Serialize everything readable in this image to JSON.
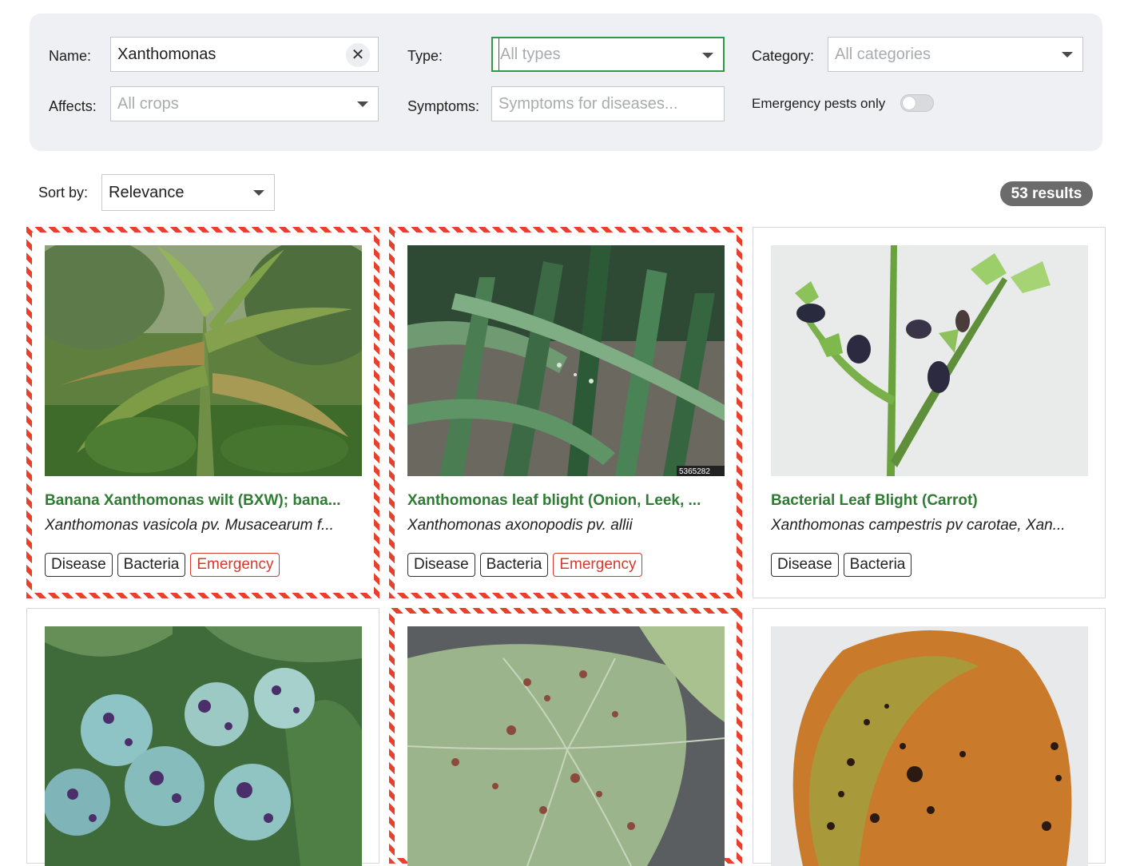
{
  "filters": {
    "name_label": "Name:",
    "name_value": "Xanthomonas",
    "clear_symbol": "✕",
    "type_label": "Type:",
    "type_placeholder": "All types",
    "category_label": "Category:",
    "category_placeholder": "All categories",
    "affects_label": "Affects:",
    "affects_placeholder": "All crops",
    "symptoms_label": "Symptoms:",
    "symptoms_placeholder": "Symptoms for diseases...",
    "emergency_label": "Emergency pests only",
    "emergency_toggle_on": false
  },
  "sort": {
    "label": "Sort by:",
    "value": "Relevance"
  },
  "results": {
    "count_label": "53 results"
  },
  "colors": {
    "title_green": "#2e7d32",
    "emergency_red": "#e8402a",
    "badge_gray": "#6b6b6b",
    "panel_bg": "#eef0f3"
  },
  "cards": [
    {
      "title": "Banana Xanthomonas wilt (BXW); bana...",
      "subtitle": "Xanthomonas vasicola pv. Musacearum f...",
      "image": "banana-plant-photo",
      "tags": [
        "Disease",
        "Bacteria",
        "Emergency"
      ],
      "emergency": true
    },
    {
      "title": "Xanthomonas leaf blight (Onion, Leek, ...",
      "subtitle": "Xanthomonas axonopodis pv. allii",
      "image": "onion-leaves-photo",
      "image_caption": "5365282",
      "tags": [
        "Disease",
        "Bacteria",
        "Emergency"
      ],
      "emergency": true
    },
    {
      "title": "Bacterial Leaf Blight (Carrot)",
      "subtitle": "Xanthomonas campestris pv carotae, Xan...",
      "image": "carrot-leaf-photo",
      "tags": [
        "Disease",
        "Bacteria"
      ],
      "emergency": false
    },
    {
      "image": "spotted-plums-photo",
      "emergency": false
    },
    {
      "image": "strawberry-leaf-photo",
      "emergency": true
    },
    {
      "image": "mango-fruit-photo",
      "emergency": false
    }
  ]
}
